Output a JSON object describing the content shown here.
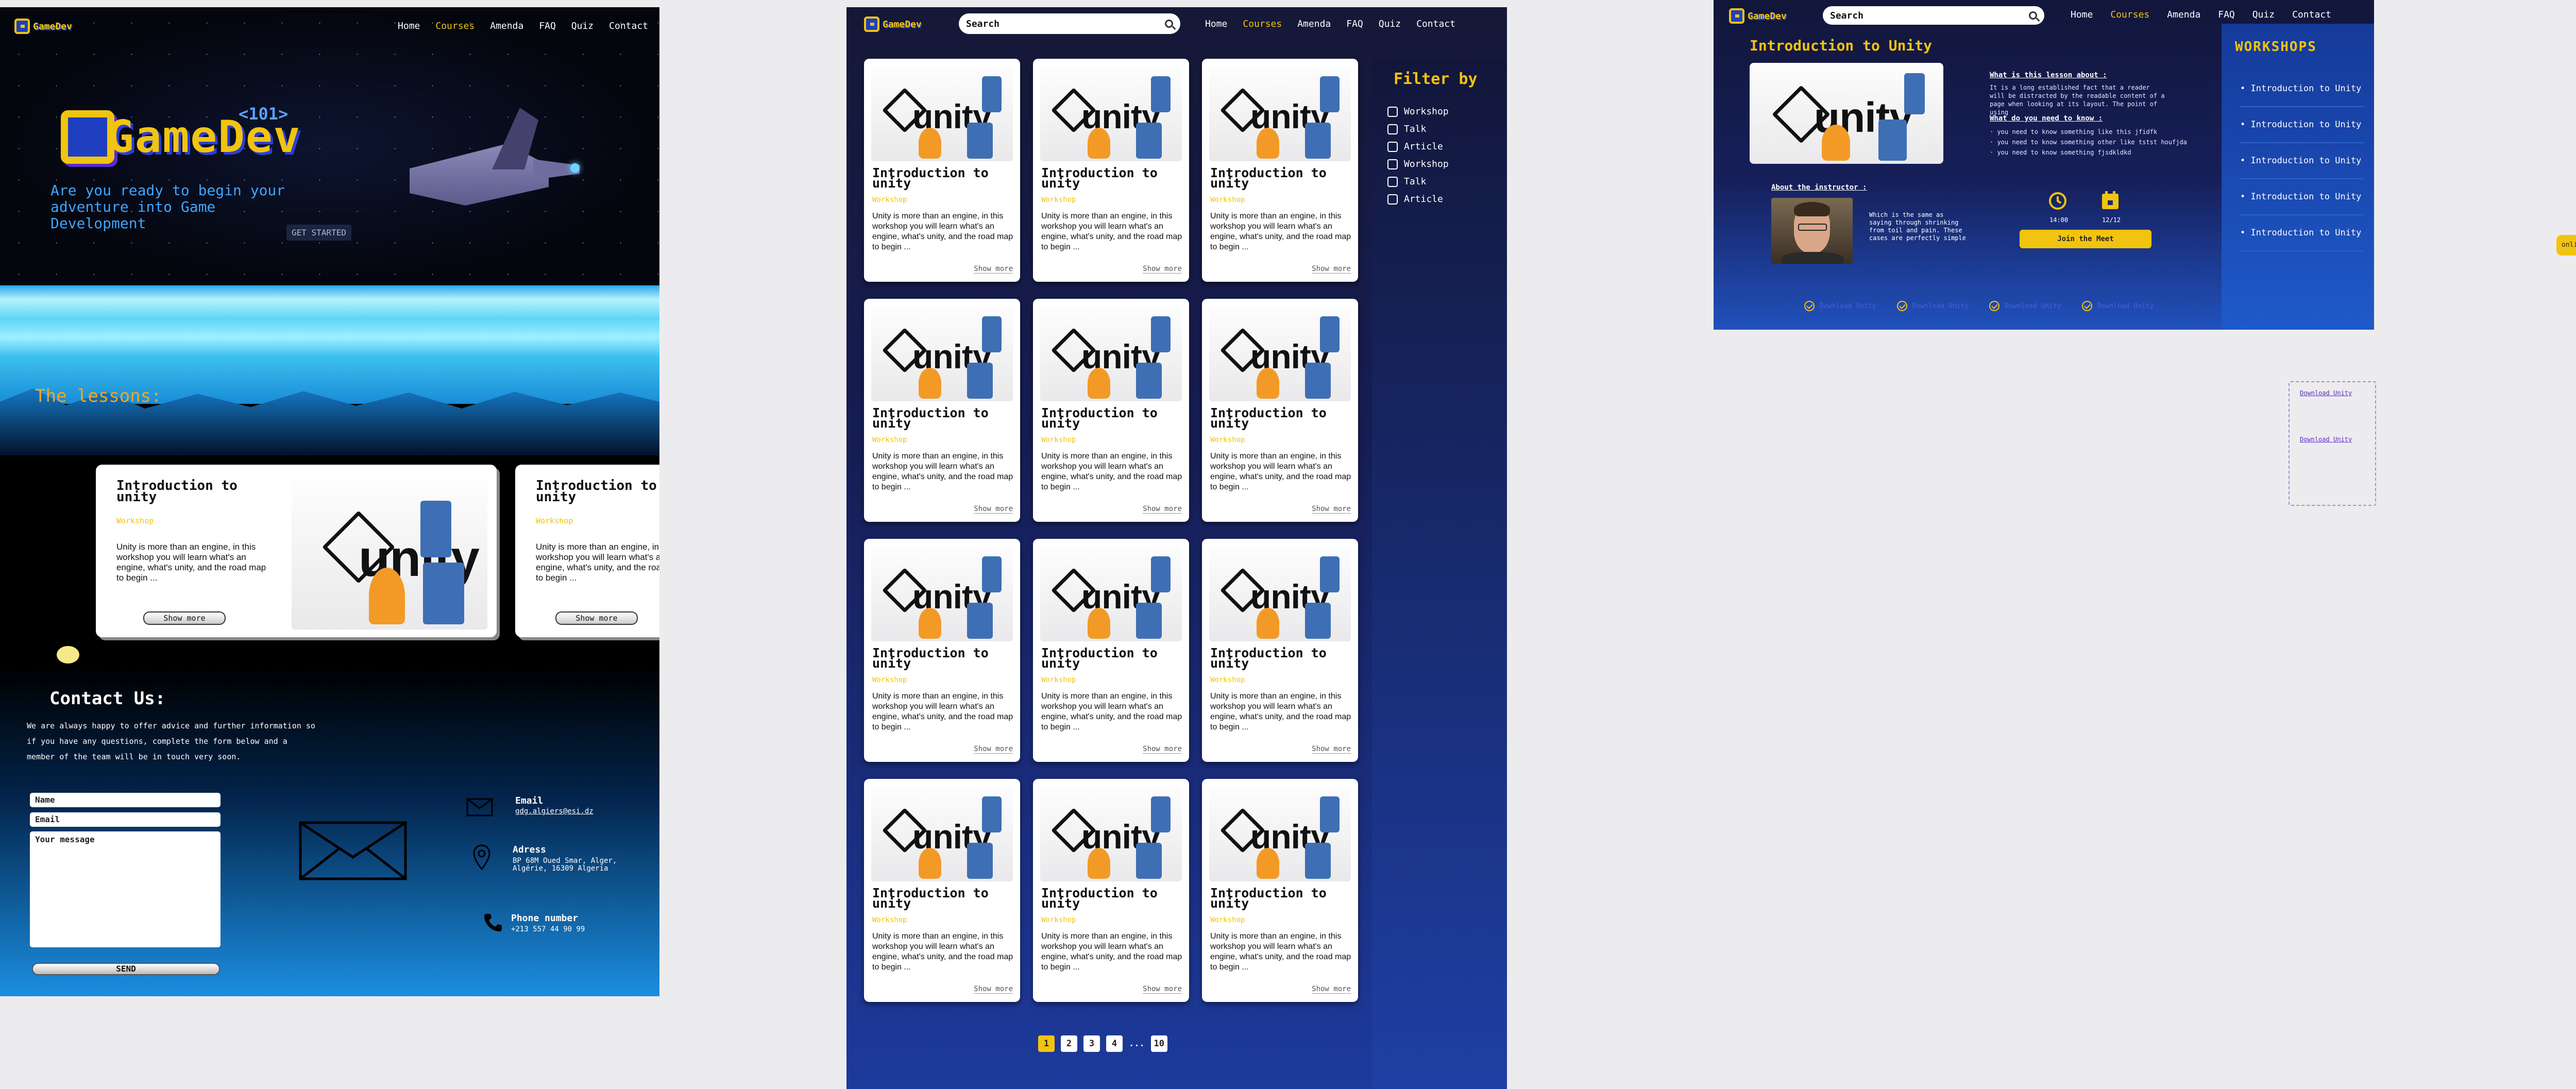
{
  "brand": {
    "name": "GameDev",
    "hero_logo": "GameDev",
    "hero_badge": "<101>"
  },
  "nav": {
    "home": "Home",
    "courses": "Courses",
    "amenda": "Amenda",
    "faq": "FAQ",
    "quiz": "Quiz",
    "contact": "Contact"
  },
  "search": {
    "placeholder": "Search"
  },
  "landing": {
    "hero_text": "Are you ready to begin your adventure into Game Development",
    "cta": "GET STARTED",
    "lessons_title": "The lessons:",
    "lesson_cards": [
      {
        "title": "Introduction to unity",
        "tag": "Workshop",
        "desc": "Unity is more than an engine, in this workshop you will learn what's an engine, what's unity, and the road map to begin ...",
        "button": "Show more"
      },
      {
        "title": "Introduction to unity",
        "tag": "Workshop",
        "desc": "Unity is more than an engine, in this workshop you will learn what's an engine, what's unity, and the road map to begin ...",
        "button": "Show more"
      }
    ],
    "contact": {
      "title": "Contact Us:",
      "intro": "We are always happy to offer advice and further information so if you have any questions, complete the form below and a member of the team will be in touch very soon.",
      "name_ph": "Name",
      "email_ph": "Email",
      "message_ph": "Your message",
      "send": "SEND",
      "email_label": "Email",
      "email_value": "gdg.algiers@esi.dz",
      "address_label": "Adress",
      "address_value": "BP 68M Oued Smar, Alger, Algérie, 16309 Algeria",
      "phone_label": "Phone number",
      "phone_value": "+213 557 44 90 99"
    }
  },
  "courses": {
    "filter_title": "Filter by",
    "filters": [
      "Workshop",
      "Talk",
      "Article",
      "Workshop",
      "Talk",
      "Article"
    ],
    "card": {
      "title": "Introduction to unity",
      "tag": "Workshop",
      "desc": "Unity is more than an engine, in this workshop you will learn what's an engine, what's unity, and the road map to begin ...",
      "more": "Show more"
    },
    "pages": [
      "1",
      "2",
      "3",
      "4",
      "...",
      "10"
    ]
  },
  "lesson": {
    "title": "Introduction to Unity",
    "what_title": "What is this lesson about :",
    "what_text": "It is a long established fact that a reader will be distracted by the readable content of a page when looking at its layout. The point of using",
    "need_title": "What do you need to know :",
    "needs": [
      "you need to know something like this jfidfk",
      "you need to know something other like tstst houfjda",
      "you need to know something fjsdkldkd"
    ],
    "instructor_title": "About the instructor :",
    "instructor_text": "Which is the same as saying through shrinking from toil and pain. These cases are perfectly simple",
    "time": "14:00",
    "date": "12/12",
    "join": "Join the Meet",
    "downloads": [
      "Download Unity",
      "Download Unity",
      "Download Unity",
      "Download Unity"
    ],
    "workshops_title": "WORKSHOPS",
    "workshops": [
      "Introduction to Unity",
      "Introduction to Unity",
      "Introduction to Unity",
      "Introduction to Unity",
      "Introduction to Unity"
    ],
    "online": "online",
    "extra_links": [
      "Download Unity",
      "Download Unity"
    ]
  }
}
